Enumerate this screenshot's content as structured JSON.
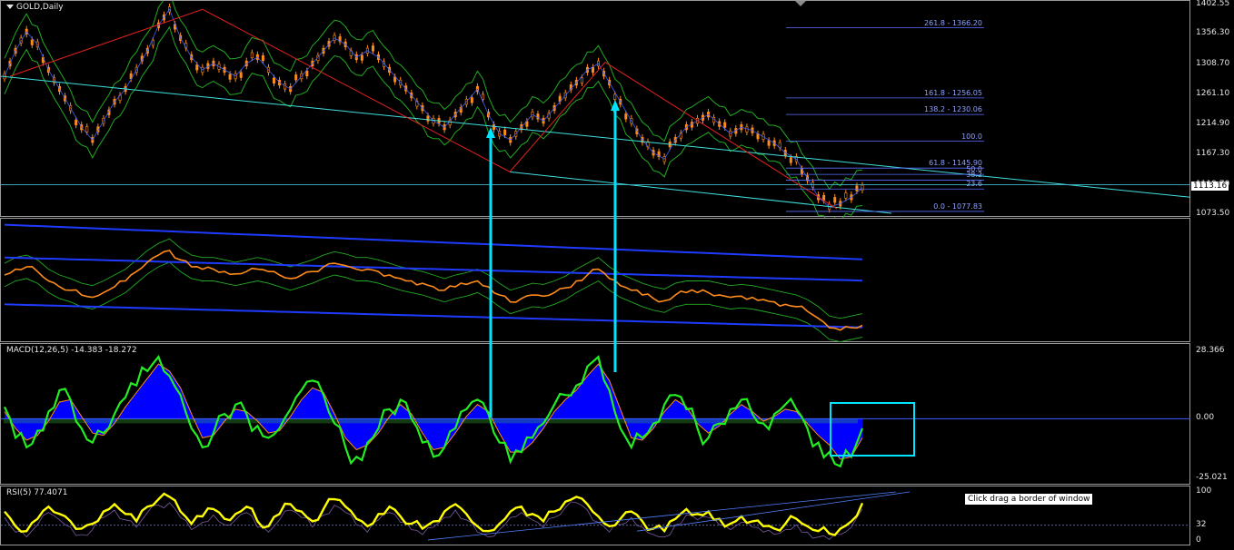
{
  "chart_data": [
    {
      "type": "line",
      "title": "GOLD,Daily",
      "y_ticks": [
        "1402.55",
        "1356.30",
        "1308.70",
        "1261.10",
        "1214.90",
        "1167.30",
        "1119.70",
        "1073.50"
      ],
      "y_tick_values": [
        1402.55,
        1356.3,
        1308.7,
        1261.1,
        1214.9,
        1167.3,
        1119.7,
        1073.5
      ],
      "ylim": [
        1073.5,
        1402.55
      ],
      "current_price": "1113.16",
      "series": [
        {
          "values": [
            1290,
            1330,
            1360,
            1340,
            1300,
            1270,
            1240,
            1210,
            1190,
            1220,
            1250,
            1270,
            1300,
            1330,
            1370,
            1395,
            1350,
            1320,
            1300,
            1310,
            1300,
            1290,
            1310,
            1320,
            1300,
            1280,
            1270,
            1290,
            1310,
            1330,
            1350,
            1340,
            1320,
            1330,
            1320,
            1300,
            1280,
            1260,
            1240,
            1220,
            1210,
            1230,
            1250,
            1270,
            1230,
            1200,
            1190,
            1210,
            1230,
            1220,
            1240,
            1260,
            1280,
            1300,
            1310,
            1280,
            1250,
            1220,
            1190,
            1170,
            1160,
            1190,
            1210,
            1220,
            1230,
            1215,
            1200,
            1210,
            1205,
            1195,
            1185,
            1170,
            1160,
            1130,
            1100,
            1085,
            1090,
            1100,
            1115
          ]
        }
      ],
      "fib_levels": [
        {
          "label": "261.8 - 1366.20",
          "value": 1366.2
        },
        {
          "label": "161.8 - 1256.05",
          "value": 1256.05
        },
        {
          "label": "138.2 - 1230.06",
          "value": 1230.06
        },
        {
          "label": "100.0",
          "value": 1188.0
        },
        {
          "label": "61.8 - 1145.90",
          "value": 1145.9
        },
        {
          "label": "50.0",
          "value": 1136.0
        },
        {
          "label": "38.2",
          "value": 1127.0
        },
        {
          "label": "23.6",
          "value": 1113.0
        },
        {
          "label": "0.0 - 1077.83",
          "value": 1077.83
        }
      ]
    },
    {
      "type": "line",
      "title": "",
      "series": [
        {
          "values": [
            0.55,
            0.6,
            0.62,
            0.58,
            0.5,
            0.45,
            0.42,
            0.38,
            0.36,
            0.4,
            0.45,
            0.5,
            0.58,
            0.66,
            0.72,
            0.76,
            0.68,
            0.62,
            0.6,
            0.6,
            0.58,
            0.56,
            0.58,
            0.6,
            0.58,
            0.55,
            0.52,
            0.55,
            0.58,
            0.62,
            0.65,
            0.63,
            0.6,
            0.6,
            0.58,
            0.55,
            0.52,
            0.5,
            0.48,
            0.45,
            0.42,
            0.45,
            0.47,
            0.5,
            0.45,
            0.38,
            0.32,
            0.35,
            0.38,
            0.37,
            0.4,
            0.44,
            0.5,
            0.55,
            0.6,
            0.52,
            0.46,
            0.42,
            0.38,
            0.35,
            0.33,
            0.38,
            0.4,
            0.4,
            0.4,
            0.38,
            0.36,
            0.37,
            0.36,
            0.34,
            0.32,
            0.3,
            0.28,
            0.24,
            0.18,
            0.1,
            0.08,
            0.1,
            0.12
          ]
        }
      ]
    },
    {
      "type": "area",
      "title": "MACD(12,26,5) -14.383 -18.272",
      "y_ticks": [
        "28.366",
        "0.00",
        "-25.021"
      ],
      "y_tick_values": [
        28.366,
        0,
        -25.021
      ],
      "ylim": [
        -25.021,
        28.366
      ],
      "series": [
        {
          "name": "MACD",
          "values": [
            5,
            -8,
            -12,
            -5,
            3,
            12,
            8,
            -4,
            -10,
            -6,
            2,
            9,
            14,
            20,
            26,
            18,
            10,
            -4,
            -12,
            -6,
            2,
            6,
            2,
            -3,
            -8,
            -4,
            4,
            12,
            16,
            10,
            -2,
            -12,
            -16,
            -10,
            -4,
            4,
            8,
            0,
            -10,
            -16,
            -12,
            -4,
            4,
            8,
            2,
            -10,
            -18,
            -14,
            -8,
            -2,
            6,
            10,
            14,
            22,
            26,
            12,
            -4,
            -12,
            -8,
            -2,
            6,
            10,
            4,
            -4,
            -8,
            -2,
            4,
            8,
            2,
            -2,
            2,
            6,
            4,
            -4,
            -10,
            -14,
            -20,
            -16,
            -4
          ]
        },
        {
          "name": "Signal",
          "values": [
            3,
            -4,
            -9,
            -7,
            -1,
            7,
            8,
            1,
            -6,
            -7,
            -2,
            5,
            11,
            17,
            23,
            20,
            13,
            2,
            -8,
            -7,
            -1,
            4,
            3,
            -1,
            -6,
            -5,
            1,
            8,
            13,
            11,
            2,
            -8,
            -13,
            -11,
            -6,
            1,
            6,
            2,
            -6,
            -13,
            -12,
            -6,
            1,
            6,
            3,
            -6,
            -14,
            -14,
            -10,
            -4,
            3,
            8,
            12,
            18,
            23,
            16,
            4,
            -8,
            -9,
            -4,
            3,
            8,
            5,
            -2,
            -6,
            -3,
            2,
            6,
            3,
            -1,
            1,
            4,
            3,
            -2,
            -7,
            -11,
            -17,
            -16,
            -8
          ]
        }
      ]
    },
    {
      "type": "line",
      "title": "RSI(5) 77.4071",
      "y_ticks": [
        "100",
        "32",
        "0"
      ],
      "y_tick_values": [
        100,
        32,
        0
      ],
      "ylim": [
        0,
        100
      ],
      "series": [
        {
          "name": "RSI",
          "values": [
            60,
            30,
            20,
            45,
            70,
            55,
            40,
            25,
            35,
            60,
            75,
            55,
            40,
            70,
            85,
            90,
            60,
            35,
            50,
            65,
            45,
            55,
            70,
            40,
            30,
            55,
            75,
            60,
            40,
            65,
            85,
            70,
            45,
            30,
            55,
            70,
            50,
            35,
            25,
            40,
            60,
            75,
            55,
            30,
            20,
            35,
            60,
            70,
            55,
            40,
            60,
            80,
            90,
            75,
            50,
            30,
            45,
            60,
            40,
            25,
            20,
            45,
            65,
            55,
            60,
            45,
            35,
            50,
            40,
            30,
            25,
            35,
            45,
            30,
            20,
            15,
            25,
            40,
            77
          ]
        }
      ]
    }
  ],
  "annotations": {
    "tooltip": "Click  drag a border of window"
  },
  "colors": {
    "price": "#ff8c1a",
    "envelope": "#22aa22",
    "trend_cyan": "#40e0e0",
    "zigzag": "#e02020",
    "fib": "#5a6eff",
    "ma_blue": "#1f3bff",
    "macd_fill": "#0000ff",
    "macd_line": "#22ee22",
    "signal": "#ff8c1a",
    "rsi": "#ffff00",
    "arrow": "#00e5ff"
  }
}
